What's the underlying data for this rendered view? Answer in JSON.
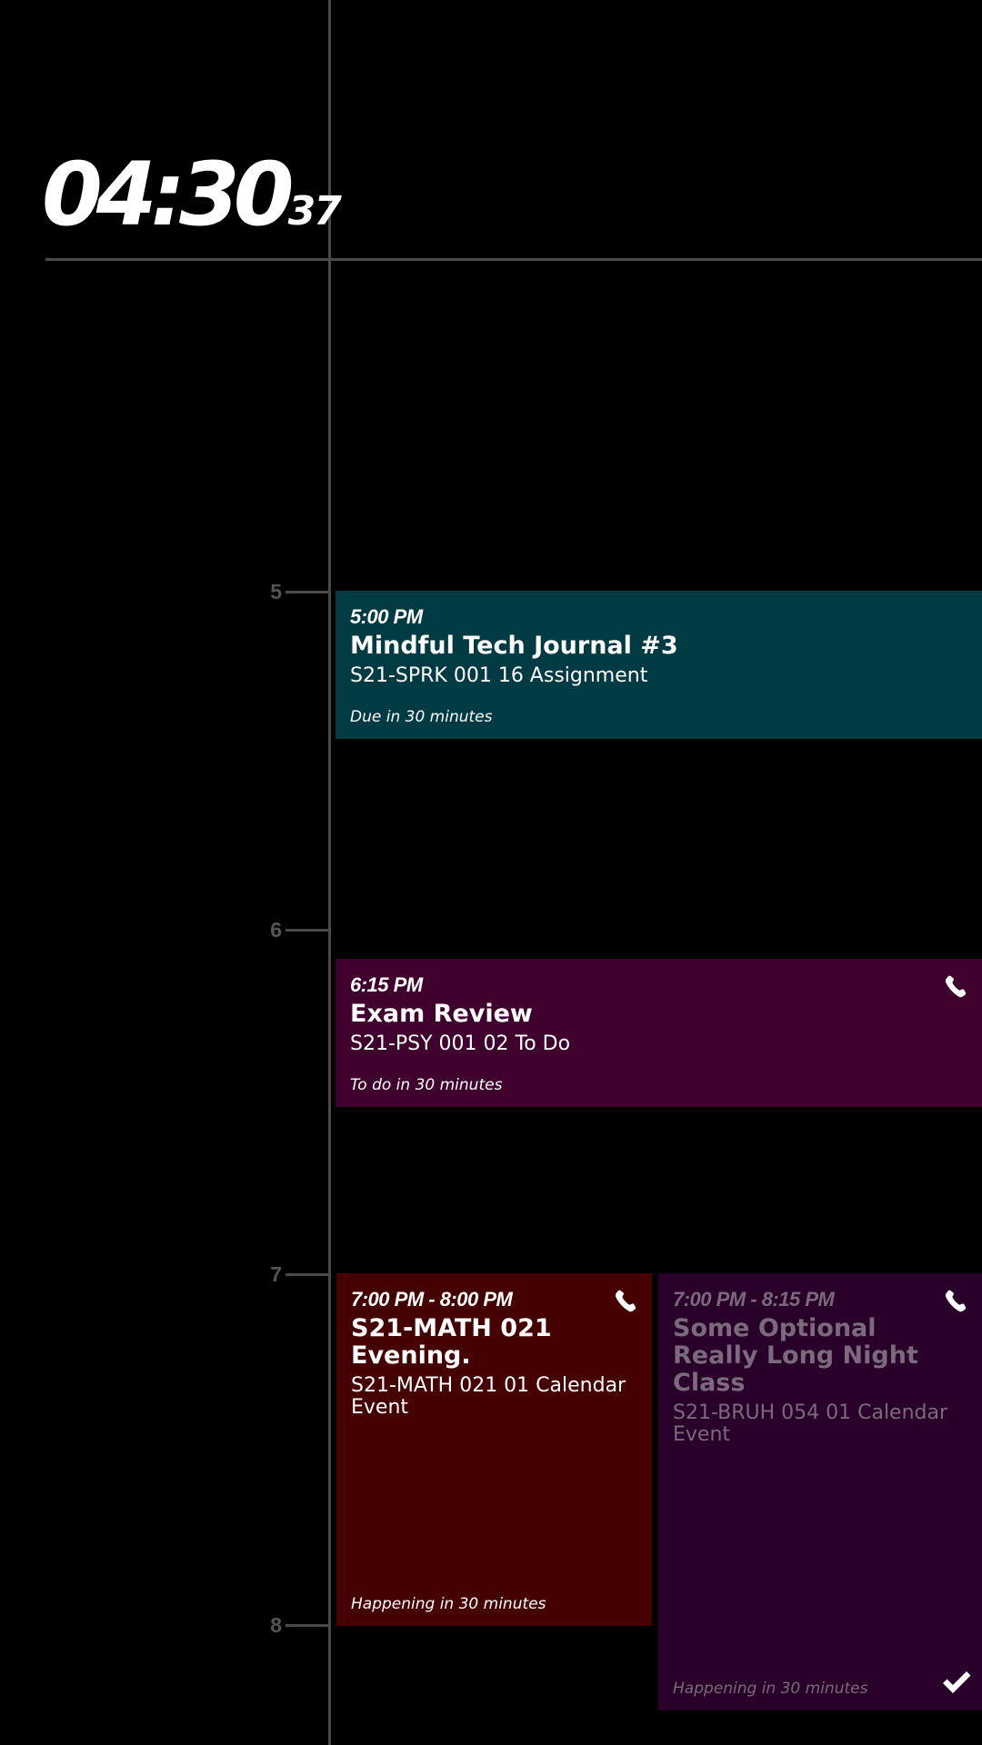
{
  "clock": {
    "hours_minutes": "04:30",
    "seconds": "37"
  },
  "hour_markers": [
    "5",
    "6",
    "7",
    "8"
  ],
  "events": [
    {
      "time": "5:00 PM",
      "title": "Mindful Tech Journal #3",
      "subtitle": "S21-SPRK 001 16 Assignment",
      "status": "Due in 30 minutes",
      "color": "#003a42"
    },
    {
      "time": "6:15 PM",
      "title": "Exam Review",
      "subtitle": "S21-PSY 001 02 To Do",
      "status": "To do in 30 minutes",
      "color": "#3f002d",
      "icon": "phone-icon"
    },
    {
      "time": "7:00 PM - 8:00 PM",
      "title": "S21-MATH 021 Evening.",
      "subtitle": "S21-MATH 021 01 Calendar Event",
      "status": "Happening in 30 minutes",
      "color": "#450001",
      "icon": "phone-icon"
    },
    {
      "time": "7:00 PM - 8:15 PM",
      "title": "Some Optional Really Long Night Class",
      "subtitle": "S21-BRUH 054 01 Calendar Event",
      "status": "Happening in 30 minutes",
      "color": "#29002a",
      "icon": "phone-icon",
      "done_icon": "checkmark-icon"
    }
  ]
}
